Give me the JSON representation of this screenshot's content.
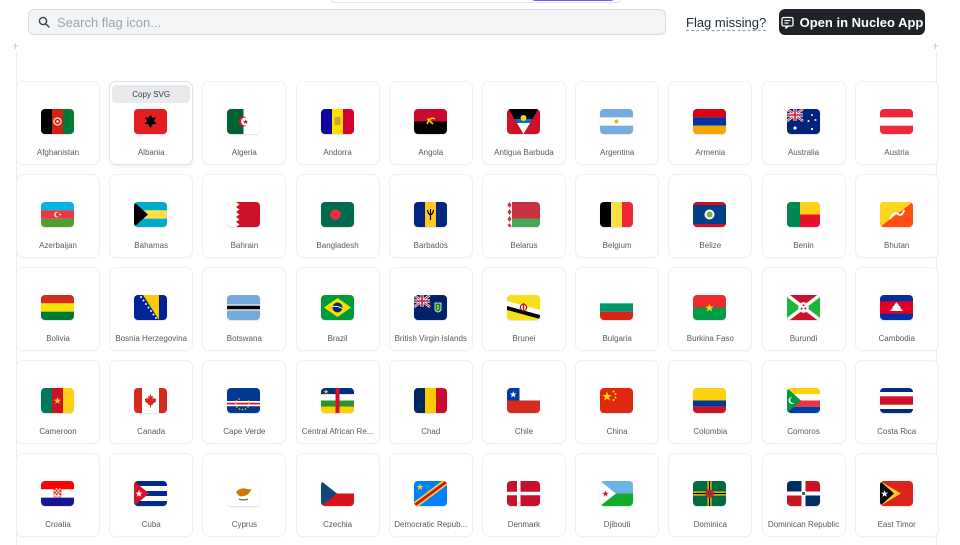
{
  "search": {
    "placeholder": "Search flag icon..."
  },
  "header": {
    "missing_label": "Flag missing?",
    "open_label": "Open in Nucleo App"
  },
  "tooltip": {
    "label": "Copy SVG"
  },
  "flags": [
    {
      "name": "Afghanistan",
      "icon": "afghanistan-flag-icon"
    },
    {
      "name": "Albania",
      "icon": "albania-flag-icon"
    },
    {
      "name": "Algeria",
      "icon": "algeria-flag-icon"
    },
    {
      "name": "Andorra",
      "icon": "andorra-flag-icon"
    },
    {
      "name": "Angola",
      "icon": "angola-flag-icon"
    },
    {
      "name": "Antigua Barbuda",
      "icon": "antigua-barbuda-flag-icon"
    },
    {
      "name": "Argentina",
      "icon": "argentina-flag-icon"
    },
    {
      "name": "Armenia",
      "icon": "armenia-flag-icon"
    },
    {
      "name": "Australia",
      "icon": "australia-flag-icon"
    },
    {
      "name": "Austria",
      "icon": "austria-flag-icon"
    },
    {
      "name": "Azerbaijan",
      "icon": "azerbaijan-flag-icon"
    },
    {
      "name": "Bahamas",
      "icon": "bahamas-flag-icon"
    },
    {
      "name": "Bahrain",
      "icon": "bahrain-flag-icon"
    },
    {
      "name": "Bangladesh",
      "icon": "bangladesh-flag-icon"
    },
    {
      "name": "Barbados",
      "icon": "barbados-flag-icon"
    },
    {
      "name": "Belarus",
      "icon": "belarus-flag-icon"
    },
    {
      "name": "Belgium",
      "icon": "belgium-flag-icon"
    },
    {
      "name": "Belize",
      "icon": "belize-flag-icon"
    },
    {
      "name": "Benin",
      "icon": "benin-flag-icon"
    },
    {
      "name": "Bhutan",
      "icon": "bhutan-flag-icon"
    },
    {
      "name": "Bolivia",
      "icon": "bolivia-flag-icon"
    },
    {
      "name": "Bosnia Herzegovina",
      "icon": "bosnia-herzegovina-flag-icon"
    },
    {
      "name": "Botswana",
      "icon": "botswana-flag-icon"
    },
    {
      "name": "Brazil",
      "icon": "brazil-flag-icon"
    },
    {
      "name": "British Virgin Islands",
      "icon": "british-virgin-islands-flag-icon"
    },
    {
      "name": "Brunei",
      "icon": "brunei-flag-icon"
    },
    {
      "name": "Bulgaria",
      "icon": "bulgaria-flag-icon"
    },
    {
      "name": "Burkina Faso",
      "icon": "burkina-faso-flag-icon"
    },
    {
      "name": "Burundi",
      "icon": "burundi-flag-icon"
    },
    {
      "name": "Cambodia",
      "icon": "cambodia-flag-icon"
    },
    {
      "name": "Cameroon",
      "icon": "cameroon-flag-icon"
    },
    {
      "name": "Canada",
      "icon": "canada-flag-icon"
    },
    {
      "name": "Cape Verde",
      "icon": "cape-verde-flag-icon"
    },
    {
      "name": "Central African Re...",
      "icon": "central-african-republic-flag-icon"
    },
    {
      "name": "Chad",
      "icon": "chad-flag-icon"
    },
    {
      "name": "Chile",
      "icon": "chile-flag-icon"
    },
    {
      "name": "China",
      "icon": "china-flag-icon"
    },
    {
      "name": "Colombia",
      "icon": "colombia-flag-icon"
    },
    {
      "name": "Comoros",
      "icon": "comoros-flag-icon"
    },
    {
      "name": "Costa Rica",
      "icon": "costa-rica-flag-icon"
    },
    {
      "name": "Croatia",
      "icon": "croatia-flag-icon"
    },
    {
      "name": "Cuba",
      "icon": "cuba-flag-icon"
    },
    {
      "name": "Cyprus",
      "icon": "cyprus-flag-icon"
    },
    {
      "name": "Czechia",
      "icon": "czechia-flag-icon"
    },
    {
      "name": "Democratic Repub...",
      "icon": "democratic-republic-congo-flag-icon"
    },
    {
      "name": "Denmark",
      "icon": "denmark-flag-icon"
    },
    {
      "name": "Djibouti",
      "icon": "djibouti-flag-icon"
    },
    {
      "name": "Dominica",
      "icon": "dominica-flag-icon"
    },
    {
      "name": "Dominican Republic",
      "icon": "dominican-republic-flag-icon"
    },
    {
      "name": "East Timor",
      "icon": "east-timor-flag-icon"
    }
  ]
}
